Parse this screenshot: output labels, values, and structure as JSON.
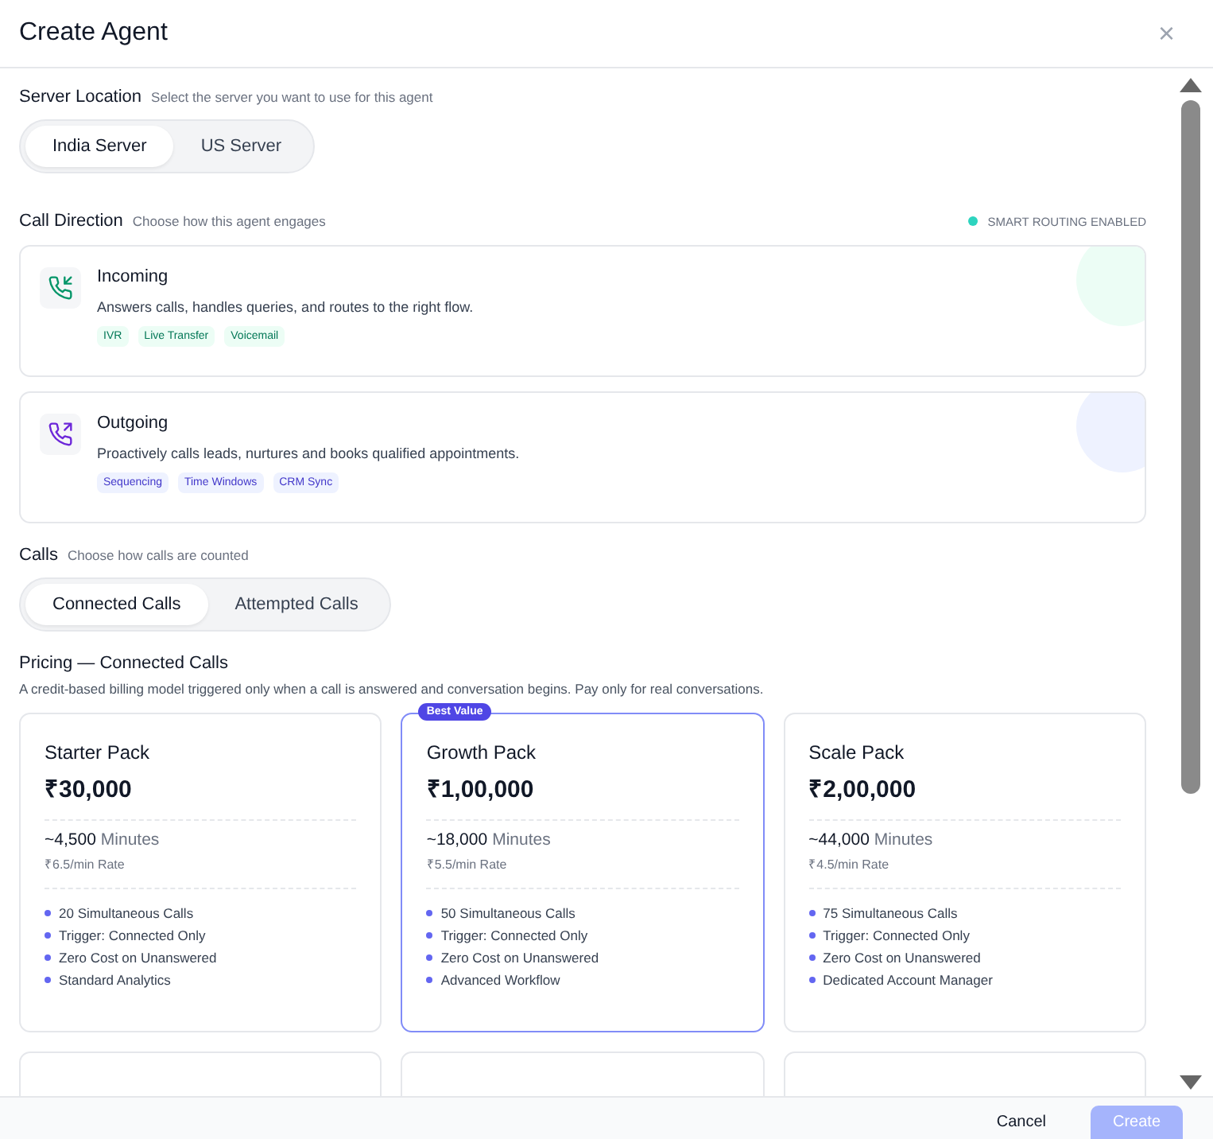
{
  "window": {
    "title": "Create Agent",
    "close": "×"
  },
  "server_location": {
    "label": "Server Location",
    "hint": "Select the server you want to use for this agent",
    "options": [
      {
        "label": "India Server",
        "selected": true
      },
      {
        "label": "US Server",
        "selected": false
      }
    ]
  },
  "call_direction": {
    "label": "Call Direction",
    "hint": "Choose how this agent engages",
    "status": "SMART ROUTING ENABLED",
    "items": [
      {
        "kind": "incoming",
        "title": "Incoming",
        "description": "Answers calls, handles queries, and routes to the right flow.",
        "tags": [
          "IVR",
          "Live Transfer",
          "Voicemail"
        ]
      },
      {
        "kind": "outgoing",
        "title": "Outgoing",
        "description": "Proactively calls leads, nurtures and books qualified appointments.",
        "tags": [
          "Sequencing",
          "Time Windows",
          "CRM Sync"
        ]
      }
    ]
  },
  "calls": {
    "label": "Calls",
    "hint": "Choose how calls are counted",
    "options": [
      {
        "label": "Connected Calls",
        "selected": true
      },
      {
        "label": "Attempted Calls",
        "selected": false
      }
    ]
  },
  "pricing": {
    "title": "Pricing — Connected Calls",
    "description": "A credit-based billing model triggered only when a call is answered and conversation begins. Pay only for real conversations.",
    "plans": [
      {
        "name": "Starter Pack",
        "price": "₹30,000",
        "minutes": "~4,500",
        "minutes_unit": "Minutes",
        "rate": "₹6.5/min Rate",
        "featured": false,
        "features": [
          "20 Simultaneous Calls",
          "Trigger: Connected Only",
          "Zero Cost on Unanswered",
          "Standard Analytics"
        ]
      },
      {
        "name": "Growth Pack",
        "price": "₹1,00,000",
        "minutes": "~18,000",
        "minutes_unit": "Minutes",
        "rate": "₹5.5/min Rate",
        "featured": true,
        "badge": "Best Value",
        "features": [
          "50 Simultaneous Calls",
          "Trigger: Connected Only",
          "Zero Cost on Unanswered",
          "Advanced Workflow"
        ]
      },
      {
        "name": "Scale Pack",
        "price": "₹2,00,000",
        "minutes": "~44,000",
        "minutes_unit": "Minutes",
        "rate": "₹4.5/min Rate",
        "featured": false,
        "features": [
          "75 Simultaneous Calls",
          "Trigger: Connected Only",
          "Zero Cost on Unanswered",
          "Dedicated Account Manager"
        ]
      }
    ]
  },
  "footer": {
    "buttons": [
      {
        "kind": "secondary",
        "label": "Cancel",
        "disabled": false
      },
      {
        "kind": "primary",
        "label": "Create",
        "disabled": true
      }
    ]
  }
}
